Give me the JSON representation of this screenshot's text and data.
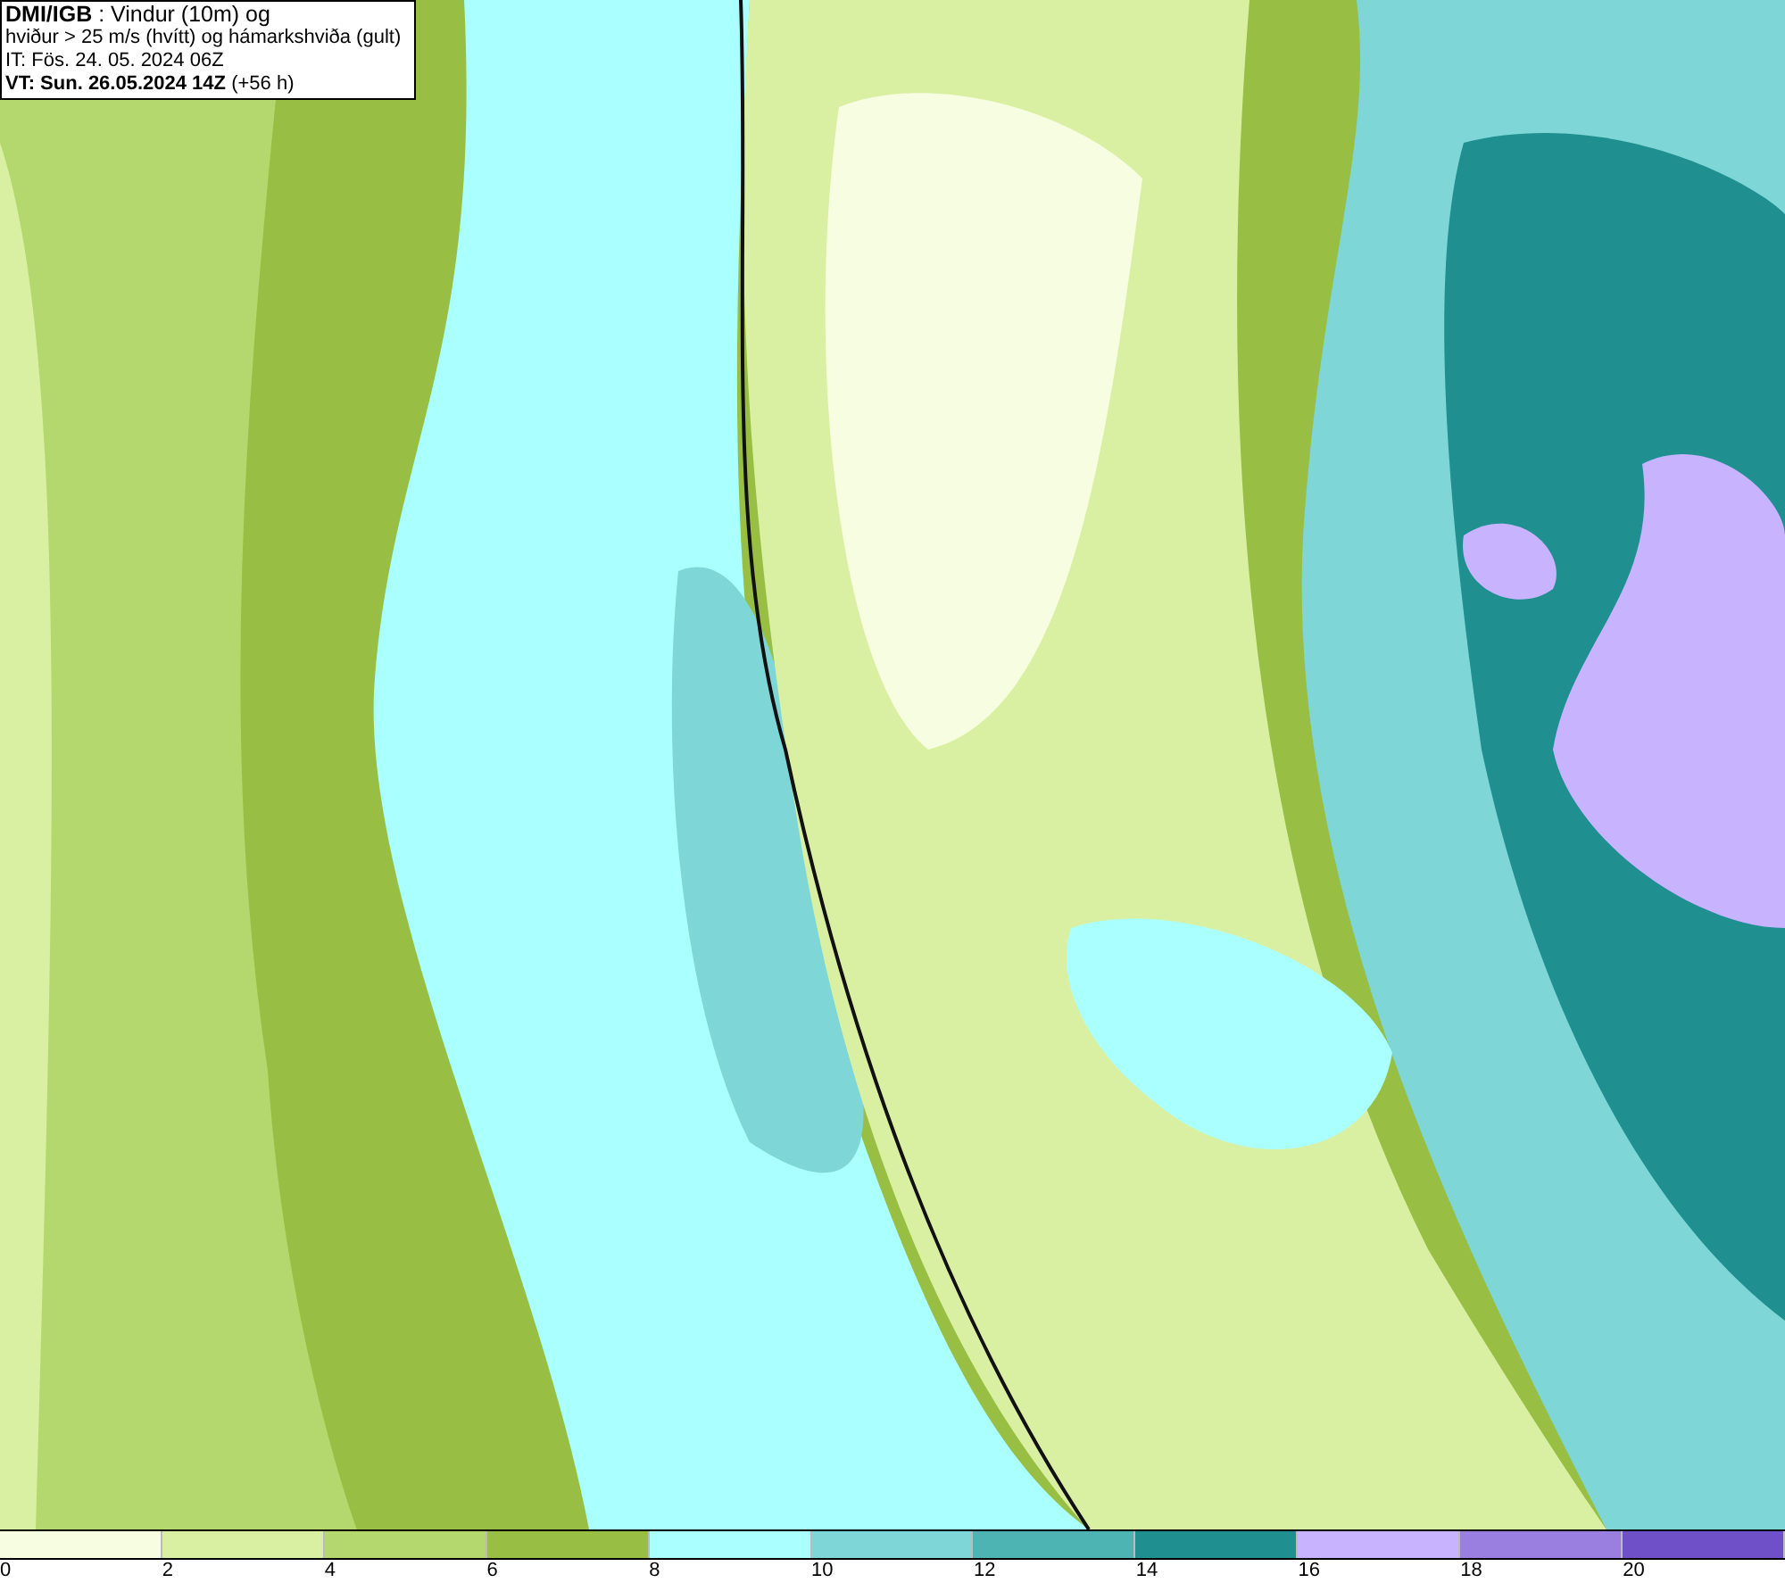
{
  "header": {
    "lines": [
      "**DMI/IGB** : Vindur (10m) og",
      "hviður > 25 m/s (hvítt) og hámarkshviða (gult)",
      "IT: Fös. 24. 05. 2024 06Z",
      "**VT: Sun. 26.05.2024 14Z** (+56 h)"
    ]
  },
  "legend": {
    "segments": [
      {
        "color": "#f7fde0"
      },
      {
        "color": "#d9f0a3"
      },
      {
        "color": "#b5d86e"
      },
      {
        "color": "#98bf44"
      },
      {
        "color": "#aaffff"
      },
      {
        "color": "#7fd6d6"
      },
      {
        "color": "#4db3b3"
      },
      {
        "color": "#1f8f8f"
      },
      {
        "color": "#c7b3ff"
      },
      {
        "color": "#9a7ee0"
      },
      {
        "color": "#7050c8"
      }
    ],
    "ticks": [
      "0",
      "2",
      "4",
      "6",
      "8",
      "10",
      "12",
      "14",
      "16",
      "18",
      "20"
    ]
  }
}
